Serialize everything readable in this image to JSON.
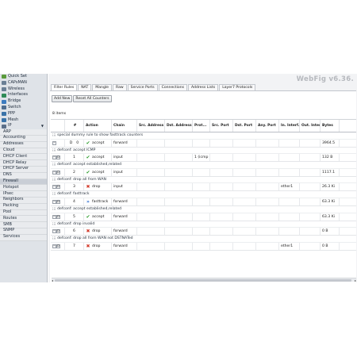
{
  "brand": "WebFig v6.36.",
  "sidebar": {
    "top_items": [
      {
        "label": "Quick Set",
        "icon": "quick-set-icon",
        "color": "#5a9a3c"
      },
      {
        "label": "CAPsMAN",
        "icon": "capsman-icon",
        "color": "#6a7f95"
      },
      {
        "label": "Wireless",
        "icon": "wireless-icon",
        "color": "#6a7f95"
      },
      {
        "label": "Interfaces",
        "icon": "interfaces-icon",
        "color": "#2e8b57"
      },
      {
        "label": "Bridge",
        "icon": "bridge-icon",
        "color": "#3c7bbf"
      },
      {
        "label": "Switch",
        "icon": "switch-icon",
        "color": "#4f6d8f"
      },
      {
        "label": "PPP",
        "icon": "ppp-icon",
        "color": "#3a73a8"
      },
      {
        "label": "Mesh",
        "icon": "mesh-icon",
        "color": "#3a73a8"
      },
      {
        "label": "IP",
        "icon": "ip-icon",
        "color": "#5b6f88",
        "arrow": "▼"
      }
    ],
    "sub_items": [
      {
        "label": "ARP"
      },
      {
        "label": "Accounting"
      },
      {
        "label": "Addresses"
      },
      {
        "label": "Cloud"
      },
      {
        "label": "DHCP Client"
      },
      {
        "label": "DHCP Relay"
      },
      {
        "label": "DHCP Server"
      },
      {
        "label": "DNS"
      },
      {
        "label": "Firewall",
        "active": true
      },
      {
        "label": "Hotspot"
      },
      {
        "label": "IPsec"
      },
      {
        "label": "Neighbors"
      },
      {
        "label": "Packing"
      },
      {
        "label": "Pool"
      },
      {
        "label": "Routes"
      },
      {
        "label": "SMB"
      },
      {
        "label": "SNMP"
      },
      {
        "label": "Services"
      }
    ]
  },
  "tabs": [
    "Filter Rules",
    "NAT",
    "Mangle",
    "Raw",
    "Service Ports",
    "Connections",
    "Address Lists",
    "Layer7 Protocols"
  ],
  "active_tab": "Filter Rules",
  "toolbar": {
    "add_new": "Add New",
    "reset_counters": "Reset All Counters"
  },
  "item_count": "8 items",
  "columns": [
    "",
    "#",
    "Action",
    "Chain",
    "Src. Address",
    "Dst. Address",
    "Prot...",
    "Src. Port",
    "Dst. Port",
    "Any. Port",
    "In. Interf...",
    "Out. Interf...",
    "Bytes"
  ],
  "rules": [
    {
      "comment": ";;; special dummy rule to show fasttrack counters",
      "ctl": "-",
      "num": "0",
      "flag": "D",
      "action": "accept",
      "action_icon": "accept-icon",
      "chain": "forward",
      "proto": "",
      "in": "",
      "bytes": "3964.5"
    },
    {
      "comment": ";;; defconf: accept ICMP",
      "ctl": "- D",
      "num": "1",
      "action": "accept",
      "action_icon": "accept-icon",
      "chain": "input",
      "proto": "1 (icmp",
      "in": "",
      "bytes": "132 B"
    },
    {
      "comment": ";;; defconf: accept established,related",
      "ctl": "- D",
      "num": "2",
      "action": "accept",
      "action_icon": "accept-icon",
      "chain": "input",
      "proto": "",
      "in": "",
      "bytes": "1117.1"
    },
    {
      "comment": ";;; defconf: drop all from WAN",
      "ctl": "- D",
      "num": "3",
      "action": "drop",
      "action_icon": "drop-icon",
      "chain": "input",
      "proto": "",
      "in": "ether1",
      "bytes": "26.3 Ki"
    },
    {
      "comment": ";;; defconf: fasttrack",
      "ctl": "- D",
      "num": "4",
      "action": "fasttrack",
      "action_icon": "fasttrack-icon",
      "chain": "forward",
      "proto": "",
      "in": "",
      "bytes": "63.3 Ki"
    },
    {
      "comment": ";;; defconf: accept established,related",
      "ctl": "- D",
      "num": "5",
      "action": "accept",
      "action_icon": "accept-icon",
      "chain": "forward",
      "proto": "",
      "in": "",
      "bytes": "63.3 Ki"
    },
    {
      "comment": ";;; defconf: drop invalid",
      "ctl": "- D",
      "num": "6",
      "action": "drop",
      "action_icon": "drop-icon",
      "chain": "forward",
      "proto": "",
      "in": "",
      "bytes": "0 B"
    },
    {
      "comment": ";;; defconf: drop all from WAN not DSTNATed",
      "ctl": "- D",
      "num": "7",
      "action": "drop",
      "action_icon": "drop-icon",
      "chain": "forward",
      "proto": "",
      "in": "ether1",
      "bytes": "0 B"
    }
  ],
  "colors": {
    "accept": "#2f9e2f",
    "drop": "#d23a2a",
    "fasttrack": "#2f6fcf"
  }
}
